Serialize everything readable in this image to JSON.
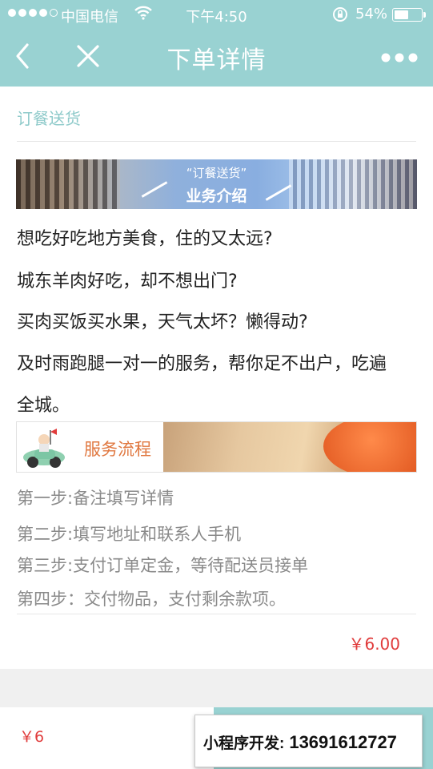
{
  "status_bar": {
    "carrier": "中国电信",
    "time": "下午4:50",
    "battery_percent": "54%",
    "battery_level": 0.54,
    "icons": [
      "signal-dots-icon",
      "wifi-icon",
      "orientation-lock-icon",
      "battery-icon"
    ]
  },
  "navbar": {
    "title": "下单详情",
    "icons": [
      "back-icon",
      "close-icon",
      "more-icon"
    ]
  },
  "main": {
    "section_title": "订餐送货",
    "banner_intro": {
      "subtitle": "“订餐送货”",
      "title": "业务介绍"
    },
    "description_lines": [
      "想吃好吃地方美食，住的又太远?",
      "城东羊肉好吃，却不想出门?",
      "买肉买饭买水果，天气太坏？懒得动?",
      "及时雨跑腿一对一的服务，帮你足不出户，吃遍",
      "全城。"
    ],
    "banner_flow": {
      "title": "服务流程"
    },
    "steps": [
      "第一步:备注填写详情",
      "第二步:填写地址和联系人手机",
      "第三步:支付订单定金，等待配送员接单",
      "第四步：交付物品，支付剩余款项。"
    ],
    "price": "￥6.00"
  },
  "bottom_bar": {
    "total": "￥6"
  },
  "overlay_ad": {
    "label": "小程序开发:",
    "phone": "13691612727"
  },
  "colors": {
    "theme": "#99d2d2",
    "section_title": "#8ecaca",
    "price": "#e03b3b",
    "flow_title": "#e07840"
  }
}
